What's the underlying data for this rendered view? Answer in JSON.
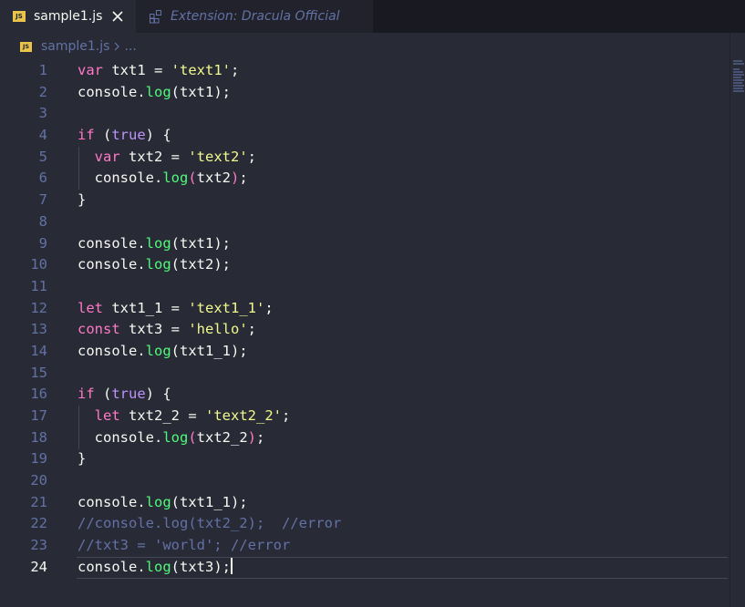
{
  "tabs": [
    {
      "label": "sample1.js",
      "icon": "js-file-icon",
      "active": true
    },
    {
      "label": "Extension: Dracula Official",
      "icon": "extensions-icon",
      "active": false
    }
  ],
  "js_badge": "JS",
  "breadcrumb": {
    "file": "sample1.js",
    "more": "..."
  },
  "editor": {
    "current_line": 24,
    "lines": [
      {
        "n": "1",
        "tokens": [
          [
            "kw",
            "var"
          ],
          [
            "p",
            " txt1 = "
          ],
          [
            "str",
            "'text1'"
          ],
          [
            "p",
            ";"
          ]
        ]
      },
      {
        "n": "2",
        "tokens": [
          [
            "p",
            "console."
          ],
          [
            "fn",
            "log"
          ],
          [
            "p",
            "(txt1);"
          ]
        ]
      },
      {
        "n": "3",
        "tokens": []
      },
      {
        "n": "4",
        "tokens": [
          [
            "kw",
            "if"
          ],
          [
            "p",
            " ("
          ],
          [
            "bool",
            "true"
          ],
          [
            "p",
            ") {"
          ]
        ]
      },
      {
        "n": "5",
        "tokens": [
          [
            "p",
            "  "
          ],
          [
            "kw",
            "var"
          ],
          [
            "p",
            " txt2 = "
          ],
          [
            "str",
            "'text2'"
          ],
          [
            "p",
            ";"
          ]
        ]
      },
      {
        "n": "6",
        "tokens": [
          [
            "p",
            "  console."
          ],
          [
            "fn",
            "log"
          ],
          [
            "kw",
            "("
          ],
          [
            "p",
            "txt2"
          ],
          [
            "kw",
            ")"
          ],
          [
            "p",
            ";"
          ]
        ]
      },
      {
        "n": "7",
        "tokens": [
          [
            "p",
            "}"
          ]
        ]
      },
      {
        "n": "8",
        "tokens": []
      },
      {
        "n": "9",
        "tokens": [
          [
            "p",
            "console."
          ],
          [
            "fn",
            "log"
          ],
          [
            "p",
            "(txt1);"
          ]
        ]
      },
      {
        "n": "10",
        "tokens": [
          [
            "p",
            "console."
          ],
          [
            "fn",
            "log"
          ],
          [
            "p",
            "(txt2);"
          ]
        ]
      },
      {
        "n": "11",
        "tokens": []
      },
      {
        "n": "12",
        "tokens": [
          [
            "kw",
            "let"
          ],
          [
            "p",
            " txt1_1 = "
          ],
          [
            "str",
            "'text1_1'"
          ],
          [
            "p",
            ";"
          ]
        ]
      },
      {
        "n": "13",
        "tokens": [
          [
            "kw",
            "const"
          ],
          [
            "p",
            " txt3 = "
          ],
          [
            "str",
            "'hello'"
          ],
          [
            "p",
            ";"
          ]
        ]
      },
      {
        "n": "14",
        "tokens": [
          [
            "p",
            "console."
          ],
          [
            "fn",
            "log"
          ],
          [
            "p",
            "(txt1_1);"
          ]
        ]
      },
      {
        "n": "15",
        "tokens": []
      },
      {
        "n": "16",
        "tokens": [
          [
            "kw",
            "if"
          ],
          [
            "p",
            " ("
          ],
          [
            "bool",
            "true"
          ],
          [
            "p",
            ") {"
          ]
        ]
      },
      {
        "n": "17",
        "tokens": [
          [
            "p",
            "  "
          ],
          [
            "kw",
            "let"
          ],
          [
            "p",
            " txt2_2 = "
          ],
          [
            "str",
            "'text2_2'"
          ],
          [
            "p",
            ";"
          ]
        ]
      },
      {
        "n": "18",
        "tokens": [
          [
            "p",
            "  console."
          ],
          [
            "fn",
            "log"
          ],
          [
            "kw",
            "("
          ],
          [
            "p",
            "txt2_2"
          ],
          [
            "kw",
            ")"
          ],
          [
            "p",
            ";"
          ]
        ]
      },
      {
        "n": "19",
        "tokens": [
          [
            "p",
            "}"
          ]
        ]
      },
      {
        "n": "20",
        "tokens": []
      },
      {
        "n": "21",
        "tokens": [
          [
            "p",
            "console."
          ],
          [
            "fn",
            "log"
          ],
          [
            "p",
            "(txt1_1);"
          ]
        ]
      },
      {
        "n": "22",
        "tokens": [
          [
            "cmt",
            "//console.log(txt2_2);  //error"
          ]
        ]
      },
      {
        "n": "23",
        "tokens": [
          [
            "cmt",
            "//txt3 = 'world'; //error"
          ]
        ]
      },
      {
        "n": "24",
        "tokens": [
          [
            "p",
            "console."
          ],
          [
            "fn",
            "log"
          ],
          [
            "p",
            "(txt3);"
          ]
        ]
      }
    ]
  },
  "colors": {
    "background": "#282a36",
    "tabbar": "#191a21",
    "keyword": "#ff79c6",
    "string": "#f1fa8c",
    "function": "#50fa7b",
    "comment": "#6272a4",
    "boolean": "#bd93f9",
    "foreground": "#f8f8f2",
    "js_badge": "#e8c44a"
  }
}
